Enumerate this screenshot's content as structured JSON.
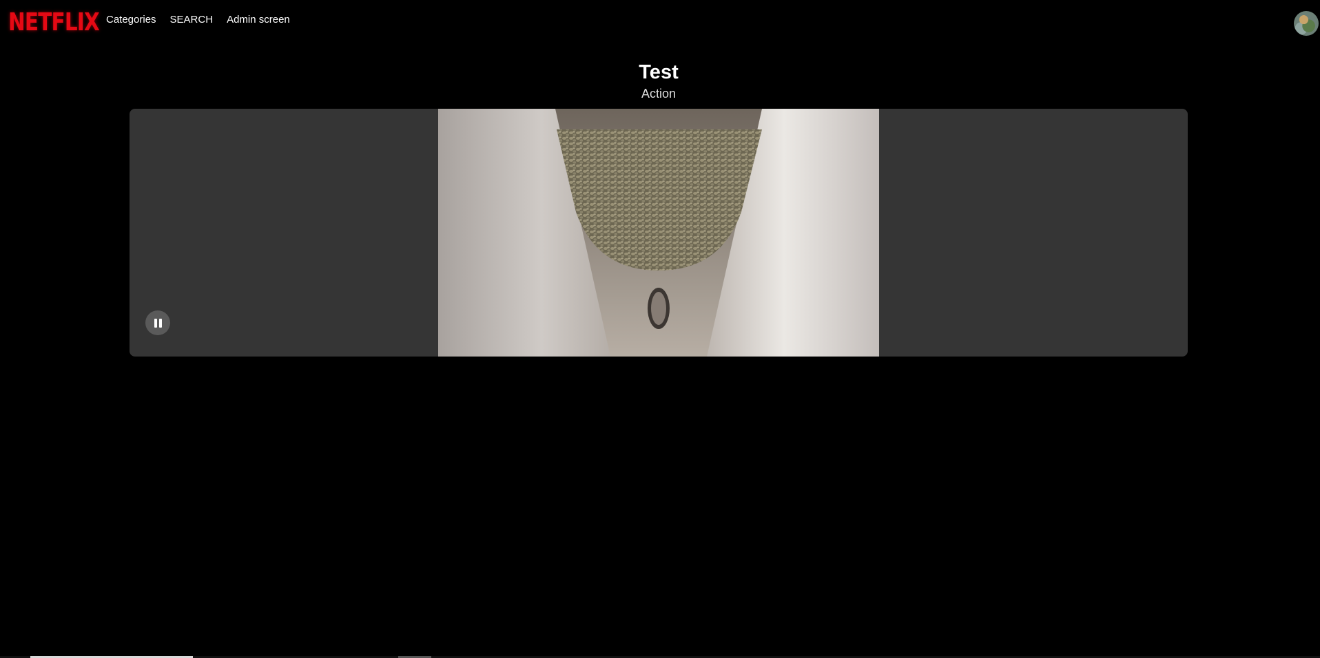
{
  "navbar": {
    "logo_text": "NETFLIX",
    "links": [
      {
        "label": "Categories"
      },
      {
        "label": "SEARCH"
      },
      {
        "label": "Admin screen"
      }
    ],
    "brand_color": "#e50914"
  },
  "video": {
    "title": "Test",
    "genre": "Action",
    "is_playing": true,
    "control_icon": "pause-icon"
  },
  "bottom_progress": {
    "fill_fraction": 0.123
  }
}
